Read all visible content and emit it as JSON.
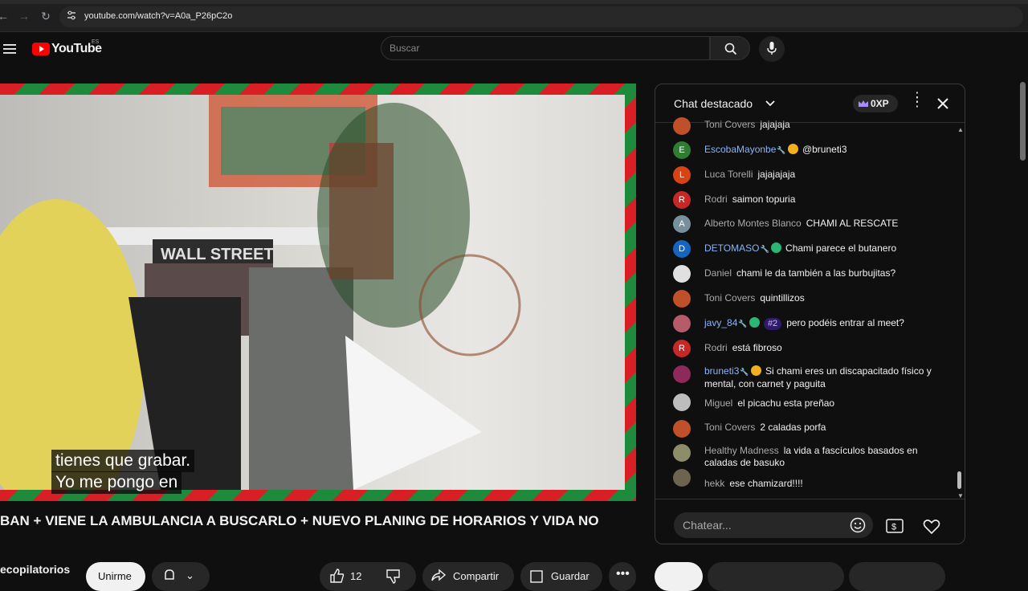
{
  "browser": {
    "url": "youtube.com/watch?v=A0a_P26pC2o"
  },
  "header": {
    "logo_text": "YouTube",
    "region": "ES",
    "search_placeholder": "Buscar"
  },
  "video": {
    "subtitle_line1": "tienes que grabar.",
    "subtitle_line2": "Yo me pongo en",
    "title": "BAN + VIENE LA AMBULANCIA A BUSCARLO + NUEVO PLANING DE HORARIOS Y VIDA NO",
    "channel": "ecopilatorios",
    "join_label": "Unirme",
    "likes": "12",
    "share_label": "Compartir",
    "save_label": "Guardar"
  },
  "chat": {
    "title": "Chat destacado",
    "xp": "0XP",
    "input_placeholder": "Chatear...",
    "messages": [
      {
        "author": "Toni Covers",
        "text": "jajajaja",
        "avatar": "",
        "color": "#c0502a"
      },
      {
        "author": "EscobaMayonbe",
        "text": "@bruneti3",
        "avatar": "E",
        "color": "#2e7d32",
        "blue": true
      },
      {
        "author": "Luca Torelli",
        "text": "jajajajaja",
        "avatar": "L",
        "color": "#d84315"
      },
      {
        "author": "Rodri",
        "text": "saimon topuria",
        "avatar": "R",
        "color": "#c62828"
      },
      {
        "author": "Alberto Montes Blanco",
        "text": "CHAMI AL RESCATE",
        "avatar": "A",
        "color": "#78909c"
      },
      {
        "author": "DETOMASO",
        "text": "Chami parece el butanero",
        "avatar": "D",
        "color": "#1565c0",
        "blue": true
      },
      {
        "author": "Daniel",
        "text": "chami le da también a las burbujitas?",
        "avatar": "",
        "color": "#e0e0e0"
      },
      {
        "author": "Toni Covers",
        "text": "quintillizos",
        "avatar": "",
        "color": "#c0502a"
      },
      {
        "author": "javy_84",
        "text": "pero podéis entrar al meet?",
        "avatar": "",
        "color": "#b75a6a",
        "blue": true,
        "rank": "#2"
      },
      {
        "author": "Rodri",
        "text": "está fibroso",
        "avatar": "R",
        "color": "#c62828"
      },
      {
        "author": "bruneti3",
        "text": "Si chami eres un discapacitado físico y mental, con carnet y paguita",
        "avatar": "",
        "color": "#8e2a5a",
        "blue": true
      },
      {
        "author": "Miguel",
        "text": "el picachu esta preñao",
        "avatar": "",
        "color": "#bdbdbd"
      },
      {
        "author": "Toni Covers",
        "text": "2 caladas porfa",
        "avatar": "",
        "color": "#c0502a"
      },
      {
        "author": "Healthy Madness",
        "text": "la vida a fascículos basados en caladas de basuko",
        "avatar": "",
        "color": "#8d8d6a"
      },
      {
        "author": "hekk",
        "text": "ese chamizard!!!!",
        "avatar": "",
        "color": "#6d6450"
      }
    ]
  },
  "colors": {
    "bg": "#0f0f0f",
    "accent_red": "#ff0000",
    "mod_blue": "#8ab4f8"
  }
}
